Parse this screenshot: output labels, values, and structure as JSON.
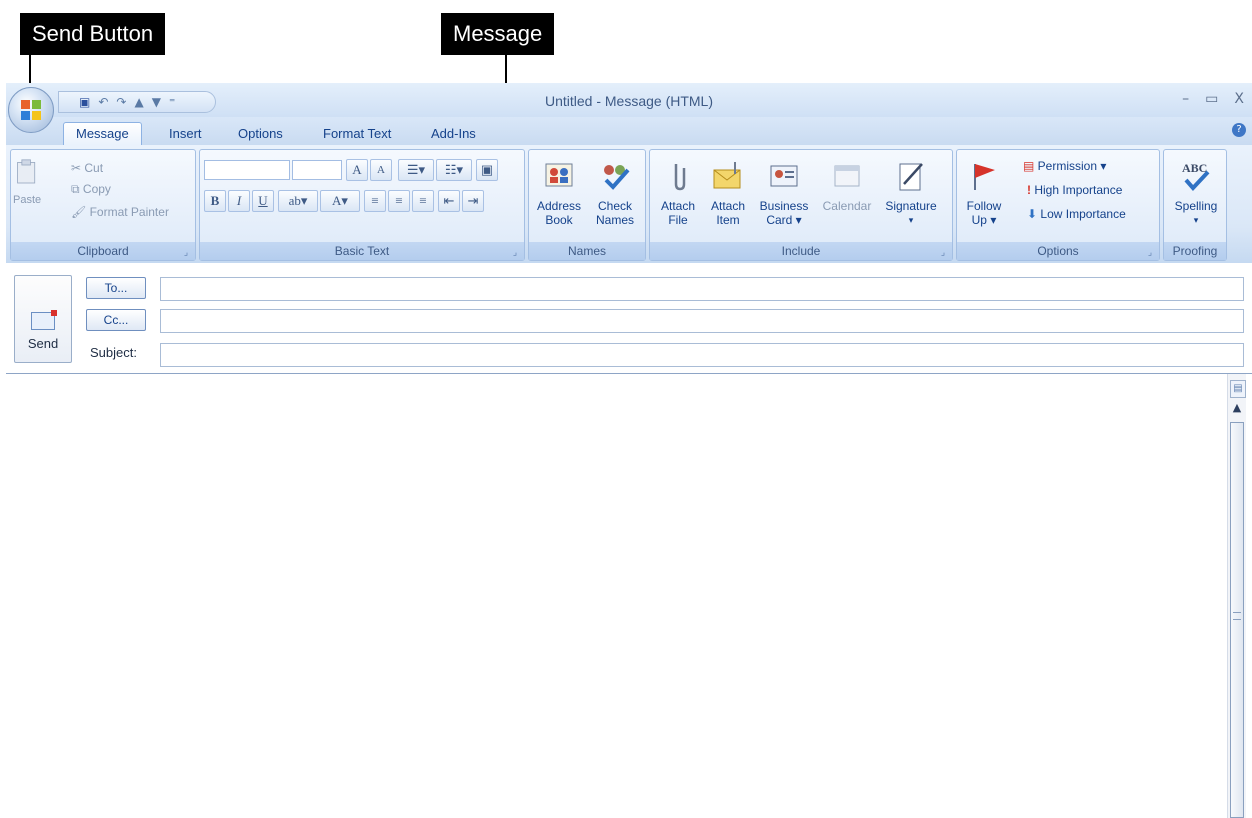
{
  "annotations": {
    "send_label": "Send Button",
    "message_label": "Message"
  },
  "window": {
    "title": "Untitled - Message (HTML)",
    "controls": [
      "–",
      "▭",
      "X"
    ]
  },
  "tabs": [
    "Message",
    "Insert",
    "Options",
    "Format Text",
    "Add-Ins"
  ],
  "ribbon": {
    "clipboard": {
      "label": "Clipboard",
      "paste": "Paste",
      "cut": "Cut",
      "copy": "Copy",
      "format_painter": "Format Painter"
    },
    "basic_text": {
      "label": "Basic Text",
      "bold": "B",
      "italic": "I",
      "underline": "U",
      "grow_font": "A",
      "shrink_font": "A"
    },
    "names": {
      "label": "Names",
      "address_book_1": "Address",
      "address_book_2": "Book",
      "check_names_1": "Check",
      "check_names_2": "Names"
    },
    "include": {
      "label": "Include",
      "attach_file_1": "Attach",
      "attach_file_2": "File",
      "attach_item_1": "Attach",
      "attach_item_2": "Item",
      "business_card_1": "Business",
      "business_card_2": "Card ▾",
      "calendar": "Calendar",
      "signature": "Signature"
    },
    "options": {
      "label": "Options",
      "follow_up_1": "Follow",
      "follow_up_2": "Up ▾",
      "permission": "Permission ▾",
      "high_importance": "High Importance",
      "low_importance": "Low Importance"
    },
    "proofing": {
      "label": "Proofing",
      "spelling": "Spelling"
    }
  },
  "header": {
    "send": "Send",
    "to": "To...",
    "cc": "Cc...",
    "subject_label": "Subject:",
    "to_value": "",
    "cc_value": "",
    "subject_value": ""
  },
  "body": {
    "text": ""
  },
  "colors": {
    "ribbon_text": "#15428b",
    "title_text": "#3e5a85",
    "callout_bg": "#000000"
  }
}
